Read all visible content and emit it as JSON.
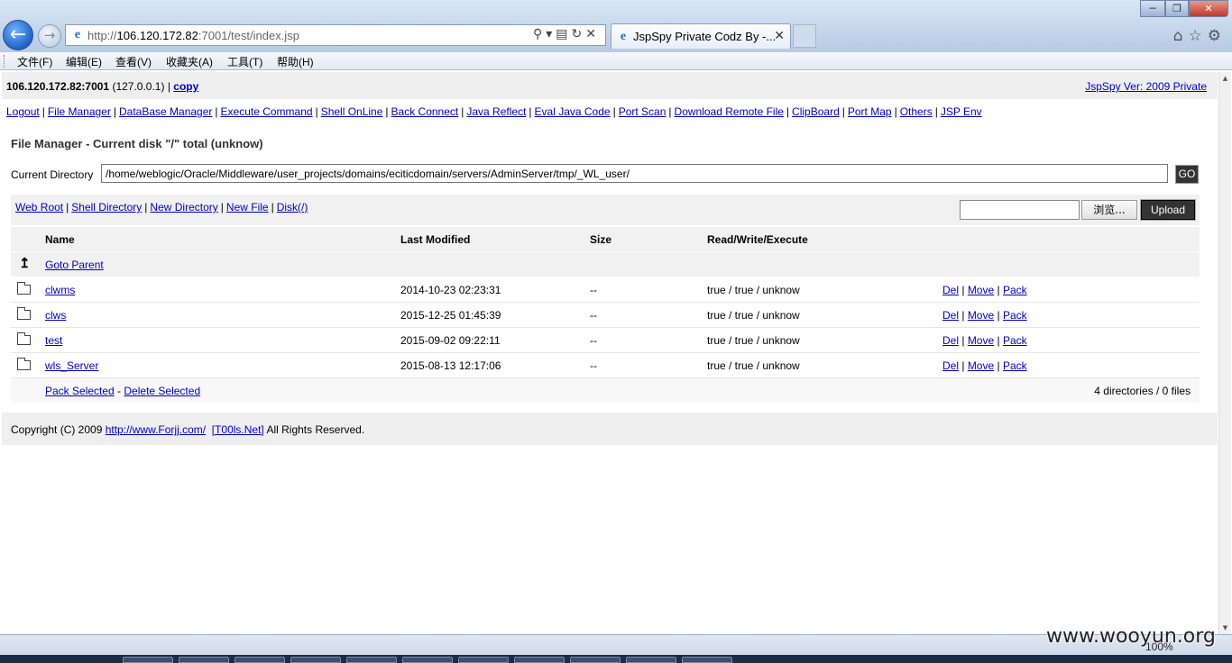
{
  "browser": {
    "url_prefix": "http://",
    "url_host": "106.120.172.82",
    "url_rest": ":7001/test/index.jsp",
    "tab_title": "JspSpy Private Codz By -...",
    "menu": [
      "文件(F)",
      "编辑(E)",
      "查看(V)",
      "收藏夹(A)",
      "工具(T)",
      "帮助(H)"
    ],
    "zoom": "100%"
  },
  "host": {
    "address": "106.120.172.82:7001",
    "local": " (127.0.0.1) | ",
    "copy_label": "copy",
    "version_link": "JspSpy Ver: 2009 Private"
  },
  "nav": [
    "Logout",
    "File Manager",
    "DataBase Manager",
    "Execute Command",
    "Shell OnLine",
    "Back Connect",
    "Java Reflect",
    "Eval Java Code",
    "Port Scan",
    "Download Remote File",
    "ClipBoard",
    "Port Map",
    "Others",
    "JSP Env"
  ],
  "file_manager": {
    "title": "File Manager - Current disk \"/\" total (unknow)",
    "current_dir_label": "Current Directory",
    "current_dir_value": "/home/weblogic/Oracle/Middleware/user_projects/domains/eciticdomain/servers/AdminServer/tmp/_WL_user/",
    "go_label": "GO",
    "tool_links": [
      "Web Root",
      "Shell Directory",
      "New Directory",
      "New File",
      "Disk(/)"
    ],
    "browse_label": "浏览...",
    "upload_label": "Upload",
    "columns": [
      "Name",
      "Last Modified",
      "Size",
      "Read/Write/Execute"
    ],
    "goto_parent": "Goto Parent",
    "rows": [
      {
        "name": "clwms",
        "modified": "2014-10-23 02:23:31",
        "size": "--",
        "rwx": "true / true / unknow"
      },
      {
        "name": "clws",
        "modified": "2015-12-25 01:45:39",
        "size": "--",
        "rwx": "true / true / unknow"
      },
      {
        "name": "test",
        "modified": "2015-09-02 09:22:11",
        "size": "--",
        "rwx": "true / true / unknow"
      },
      {
        "name": "wls_Server",
        "modified": "2015-08-13 12:17:06",
        "size": "--",
        "rwx": "true / true / unknow"
      }
    ],
    "actions": [
      "Del",
      "Move",
      "Pack"
    ],
    "pack_selected": "Pack Selected",
    "delete_selected": "Delete Selected",
    "summary": "4 directories / 0 files"
  },
  "footer": {
    "prefix": "Copyright (C) 2009 ",
    "link1": "http://www.Forjj.com/",
    "link2": "[T00ls.Net]",
    "suffix": " All Rights Reserved."
  },
  "watermark": "www.wooyun.org"
}
